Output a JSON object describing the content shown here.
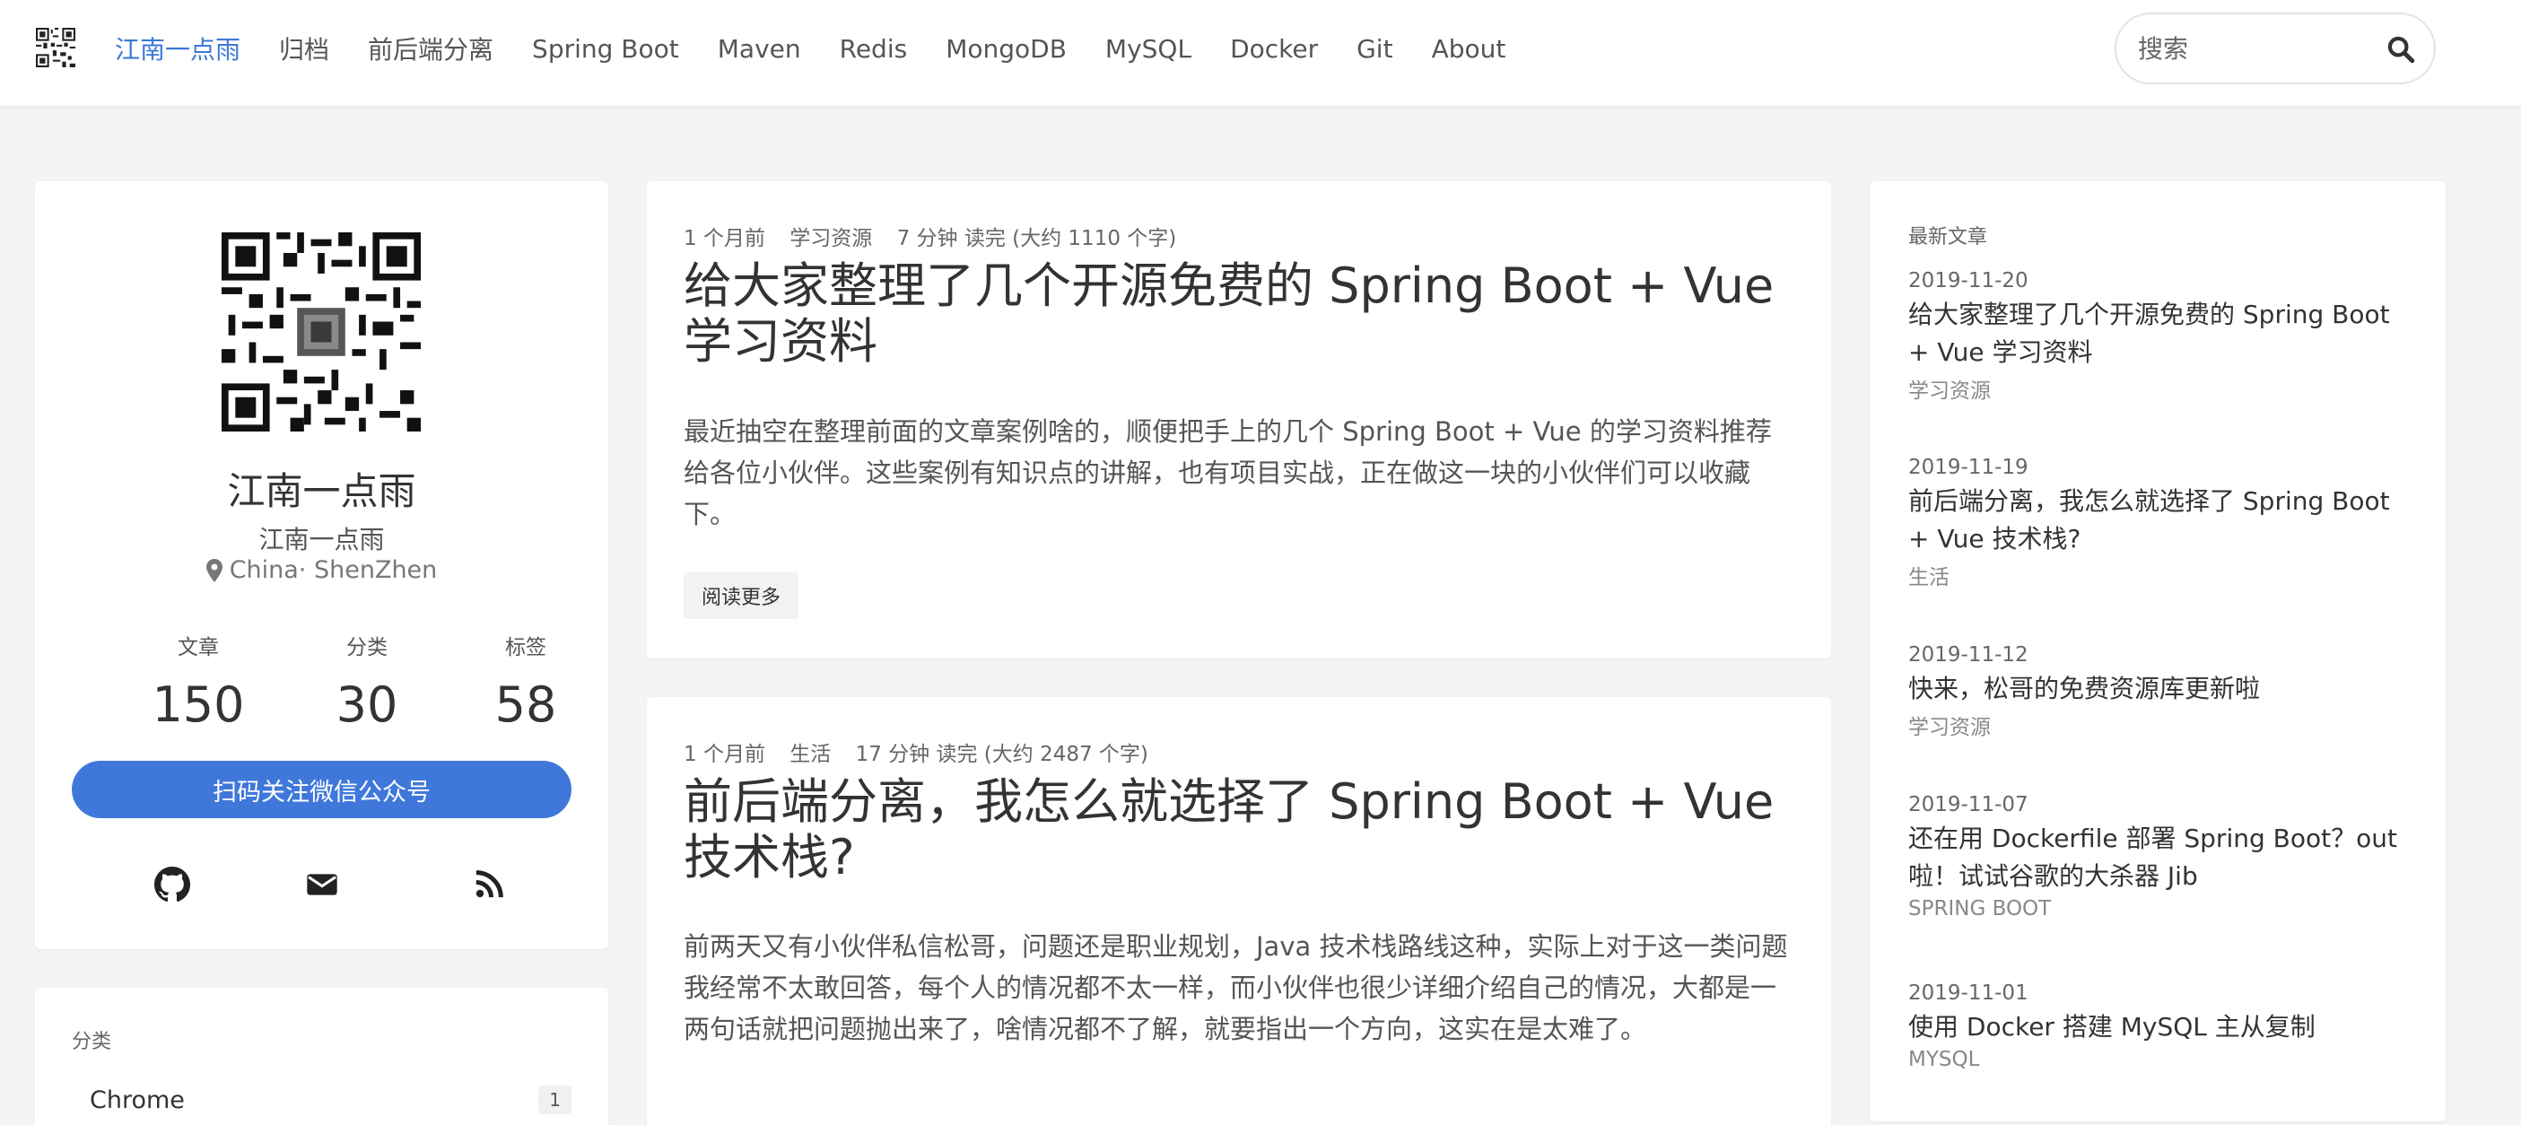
{
  "nav": {
    "links": [
      "江南一点雨",
      "归档",
      "前后端分离",
      "Spring Boot",
      "Maven",
      "Redis",
      "MongoDB",
      "MySQL",
      "Docker",
      "Git",
      "About"
    ],
    "search_placeholder": "搜索"
  },
  "profile": {
    "name": "江南一点雨",
    "subtitle": "江南一点雨",
    "location": "China· ShenZhen",
    "stats": [
      {
        "label": "文章",
        "value": "150"
      },
      {
        "label": "分类",
        "value": "30"
      },
      {
        "label": "标签",
        "value": "58"
      }
    ],
    "follow_label": "扫码关注微信公众号",
    "social_icons": [
      "github-icon",
      "envelope-icon",
      "rss-icon"
    ]
  },
  "categories": {
    "title": "分类",
    "items": [
      {
        "name": "Chrome",
        "count": "1"
      }
    ]
  },
  "posts": [
    {
      "time": "1 个月前",
      "category": "学习资源",
      "reading": "7 分钟 读完 (大约 1110 个字)",
      "title": "给大家整理了几个开源免费的 Spring Boot + Vue 学习资料",
      "excerpt": "最近抽空在整理前面的文章案例啥的，顺便把手上的几个 Spring Boot + Vue 的学习资料推荐给各位小伙伴。这些案例有知识点的讲解，也有项目实战，正在做这一块的小伙伴们可以收藏下。",
      "read_more": "阅读更多"
    },
    {
      "time": "1 个月前",
      "category": "生活",
      "reading": "17 分钟 读完 (大约 2487 个字)",
      "title": "前后端分离，我怎么就选择了 Spring Boot + Vue 技术栈?",
      "excerpt": "前两天又有小伙伴私信松哥，问题还是职业规划，Java 技术栈路线这种，实际上对于这一类问题我经常不太敢回答，每个人的情况都不太一样，而小伙伴也很少详细介绍自己的情况，大都是一两句话就把问题抛出来了，啥情况都不了解，就要指出一个方向，这实在是太难了。"
    }
  ],
  "latest": {
    "title": "最新文章",
    "items": [
      {
        "date": "2019-11-20",
        "title": "给大家整理了几个开源免费的 Spring Boot + Vue 学习资料",
        "category": "学习资源"
      },
      {
        "date": "2019-11-19",
        "title": "前后端分离，我怎么就选择了 Spring Boot + Vue 技术栈?",
        "category": "生活"
      },
      {
        "date": "2019-11-12",
        "title": "快来，松哥的免费资源库更新啦",
        "category": "学习资源"
      },
      {
        "date": "2019-11-07",
        "title": "还在用 Dockerfile 部署 Spring Boot？out 啦！试试谷歌的大杀器 Jib",
        "category": "SPRING BOOT"
      },
      {
        "date": "2019-11-01",
        "title": "使用 Docker 搭建 MySQL 主从复制",
        "category": "MYSQL"
      }
    ]
  },
  "colors": {
    "accent": "#3f78da",
    "nav_active": "#3c78d8",
    "background": "#f4f4f4"
  }
}
